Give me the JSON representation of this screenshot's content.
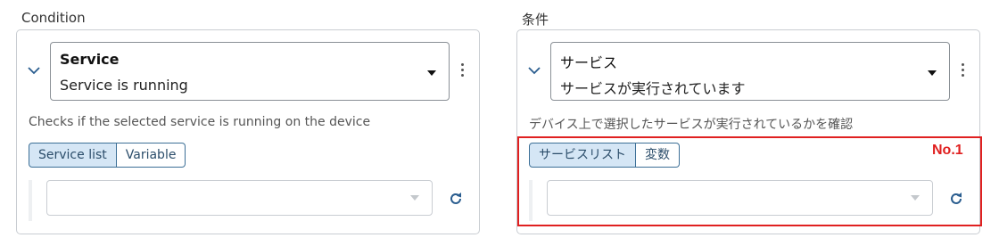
{
  "panels": [
    {
      "section_label": "Condition",
      "select": {
        "title": "Service",
        "subtitle": "Service is running"
      },
      "description": "Checks if the selected service is running on the device",
      "toggle": {
        "selected": "Service list",
        "other": "Variable"
      },
      "dropdown": {
        "value": ""
      },
      "icons": {
        "collapse": "chevron-down-icon",
        "menu": "kebab-menu-icon",
        "refresh": "refresh-icon"
      }
    },
    {
      "section_label": "条件",
      "select": {
        "title": "サービス",
        "subtitle": "サービスが実行されています"
      },
      "description": "デバイス上で選択したサービスが実行されているかを確認",
      "toggle": {
        "selected": "サービスリスト",
        "other": "変数"
      },
      "dropdown": {
        "value": ""
      },
      "icons": {
        "collapse": "chevron-down-icon",
        "menu": "kebab-menu-icon",
        "refresh": "refresh-icon"
      }
    }
  ],
  "annotation": {
    "label": "No.1",
    "color": "#e02020"
  },
  "colors": {
    "accent": "#3c6f96",
    "selected_bg": "#d5e6f5",
    "border": "#c9cdd2"
  }
}
